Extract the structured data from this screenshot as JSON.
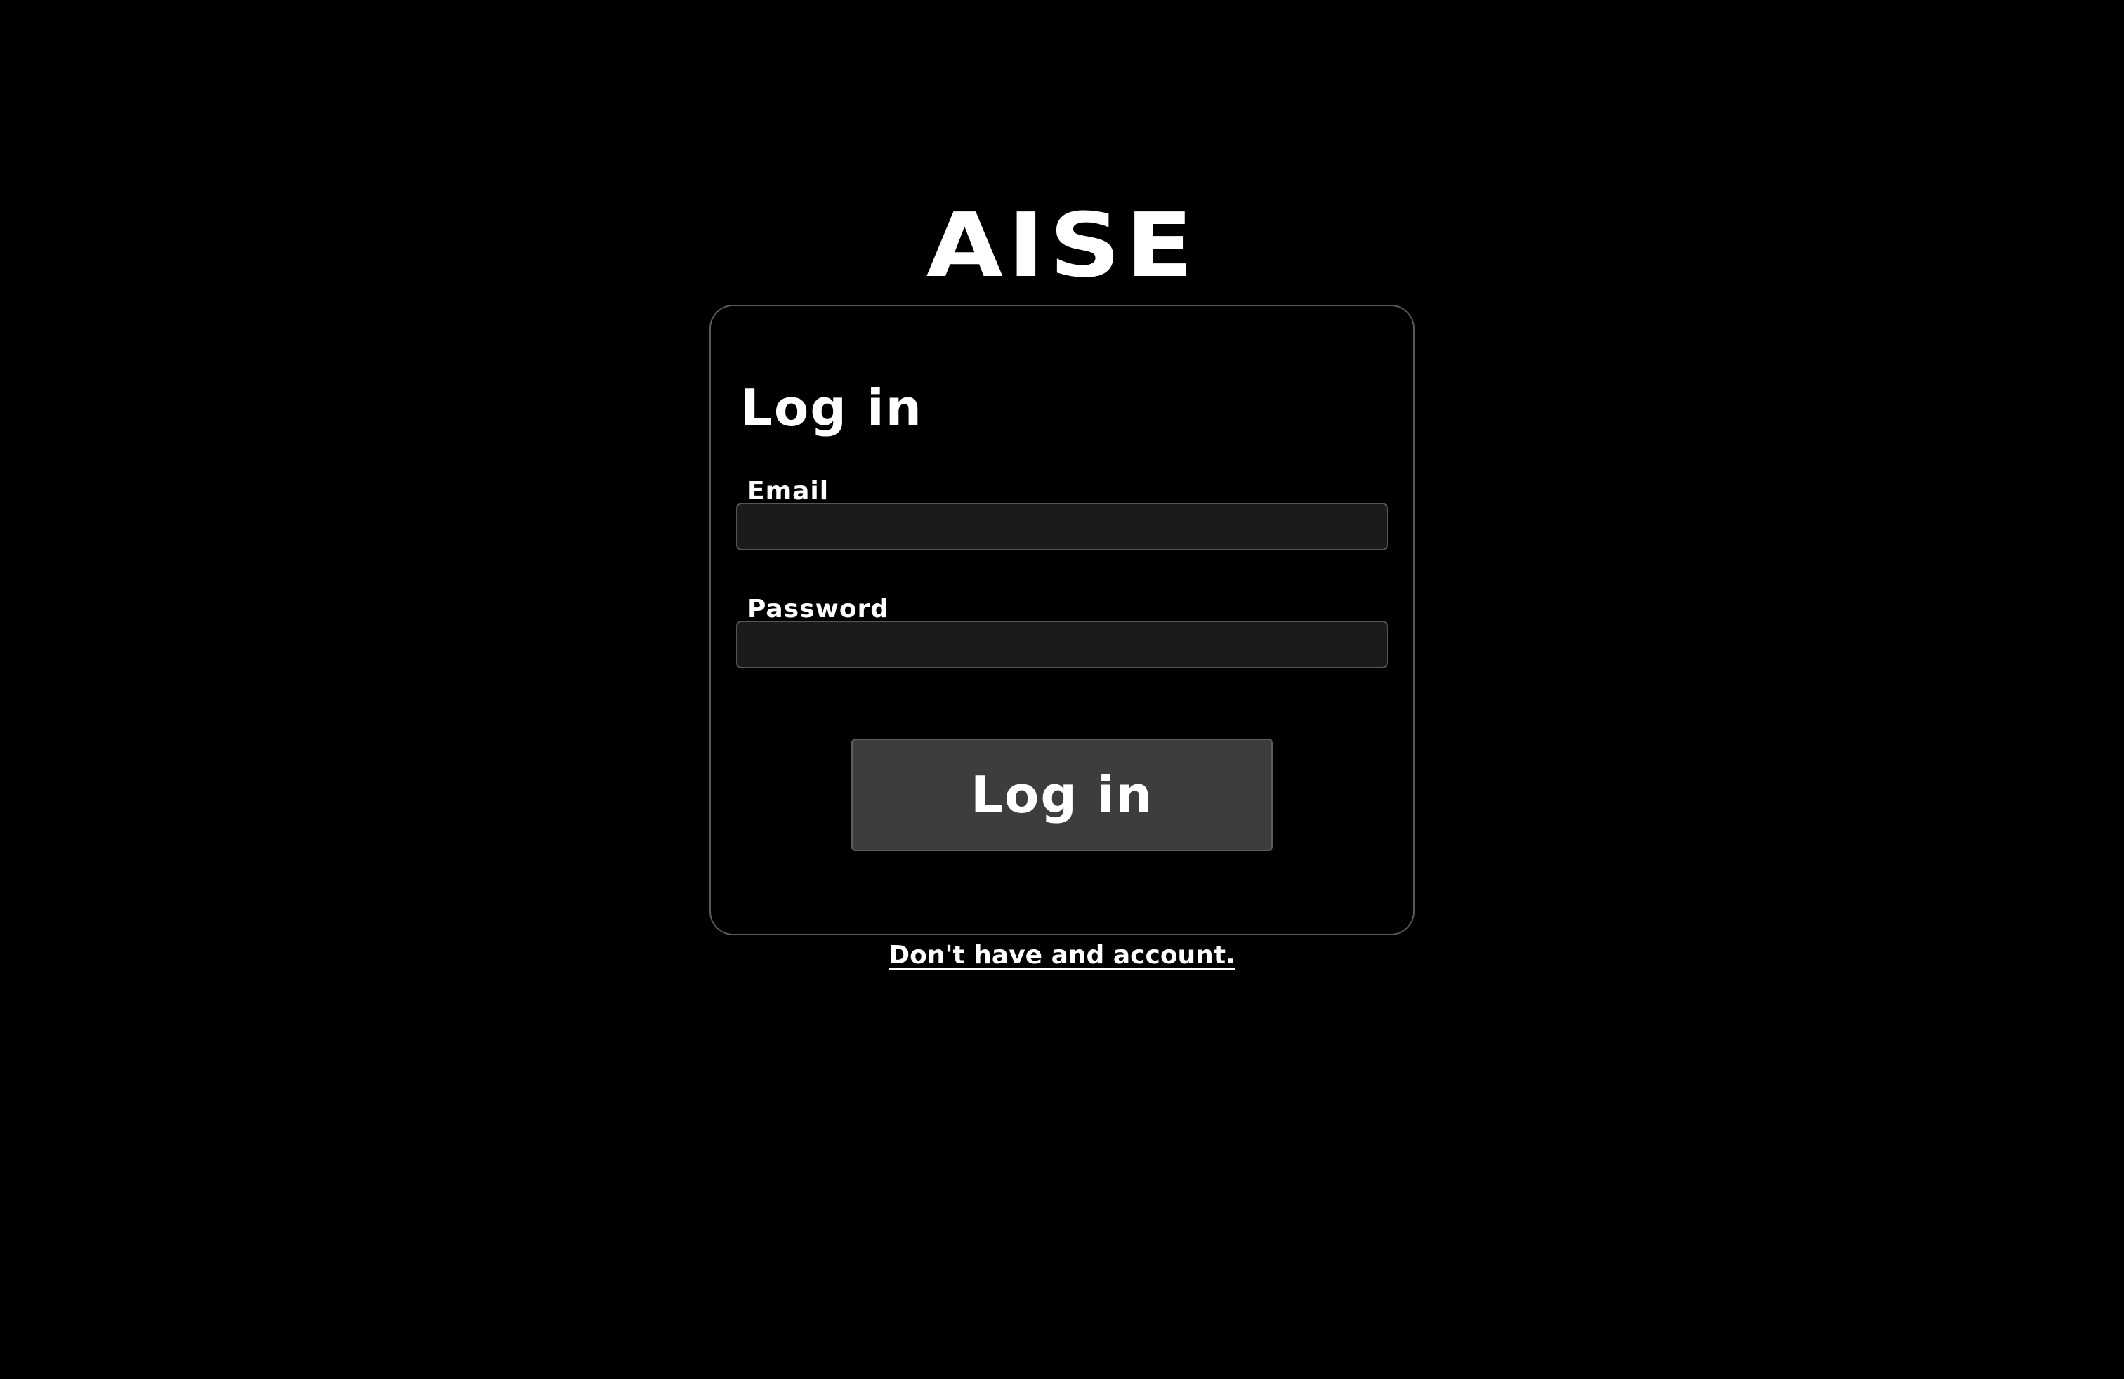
{
  "brand": {
    "title": "AISE"
  },
  "login_card": {
    "title": "Log in",
    "email": {
      "label": "Email",
      "value": "",
      "placeholder": ""
    },
    "password": {
      "label": "Password",
      "value": "",
      "placeholder": ""
    },
    "submit_label": "Log in"
  },
  "signup": {
    "link_text": "Don't have and account."
  },
  "colors": {
    "background": "#000000",
    "text": "#ffffff",
    "card_border": "#5a5a5a",
    "input_background": "#1b1b1b",
    "button_background": "#3d3d3d"
  }
}
